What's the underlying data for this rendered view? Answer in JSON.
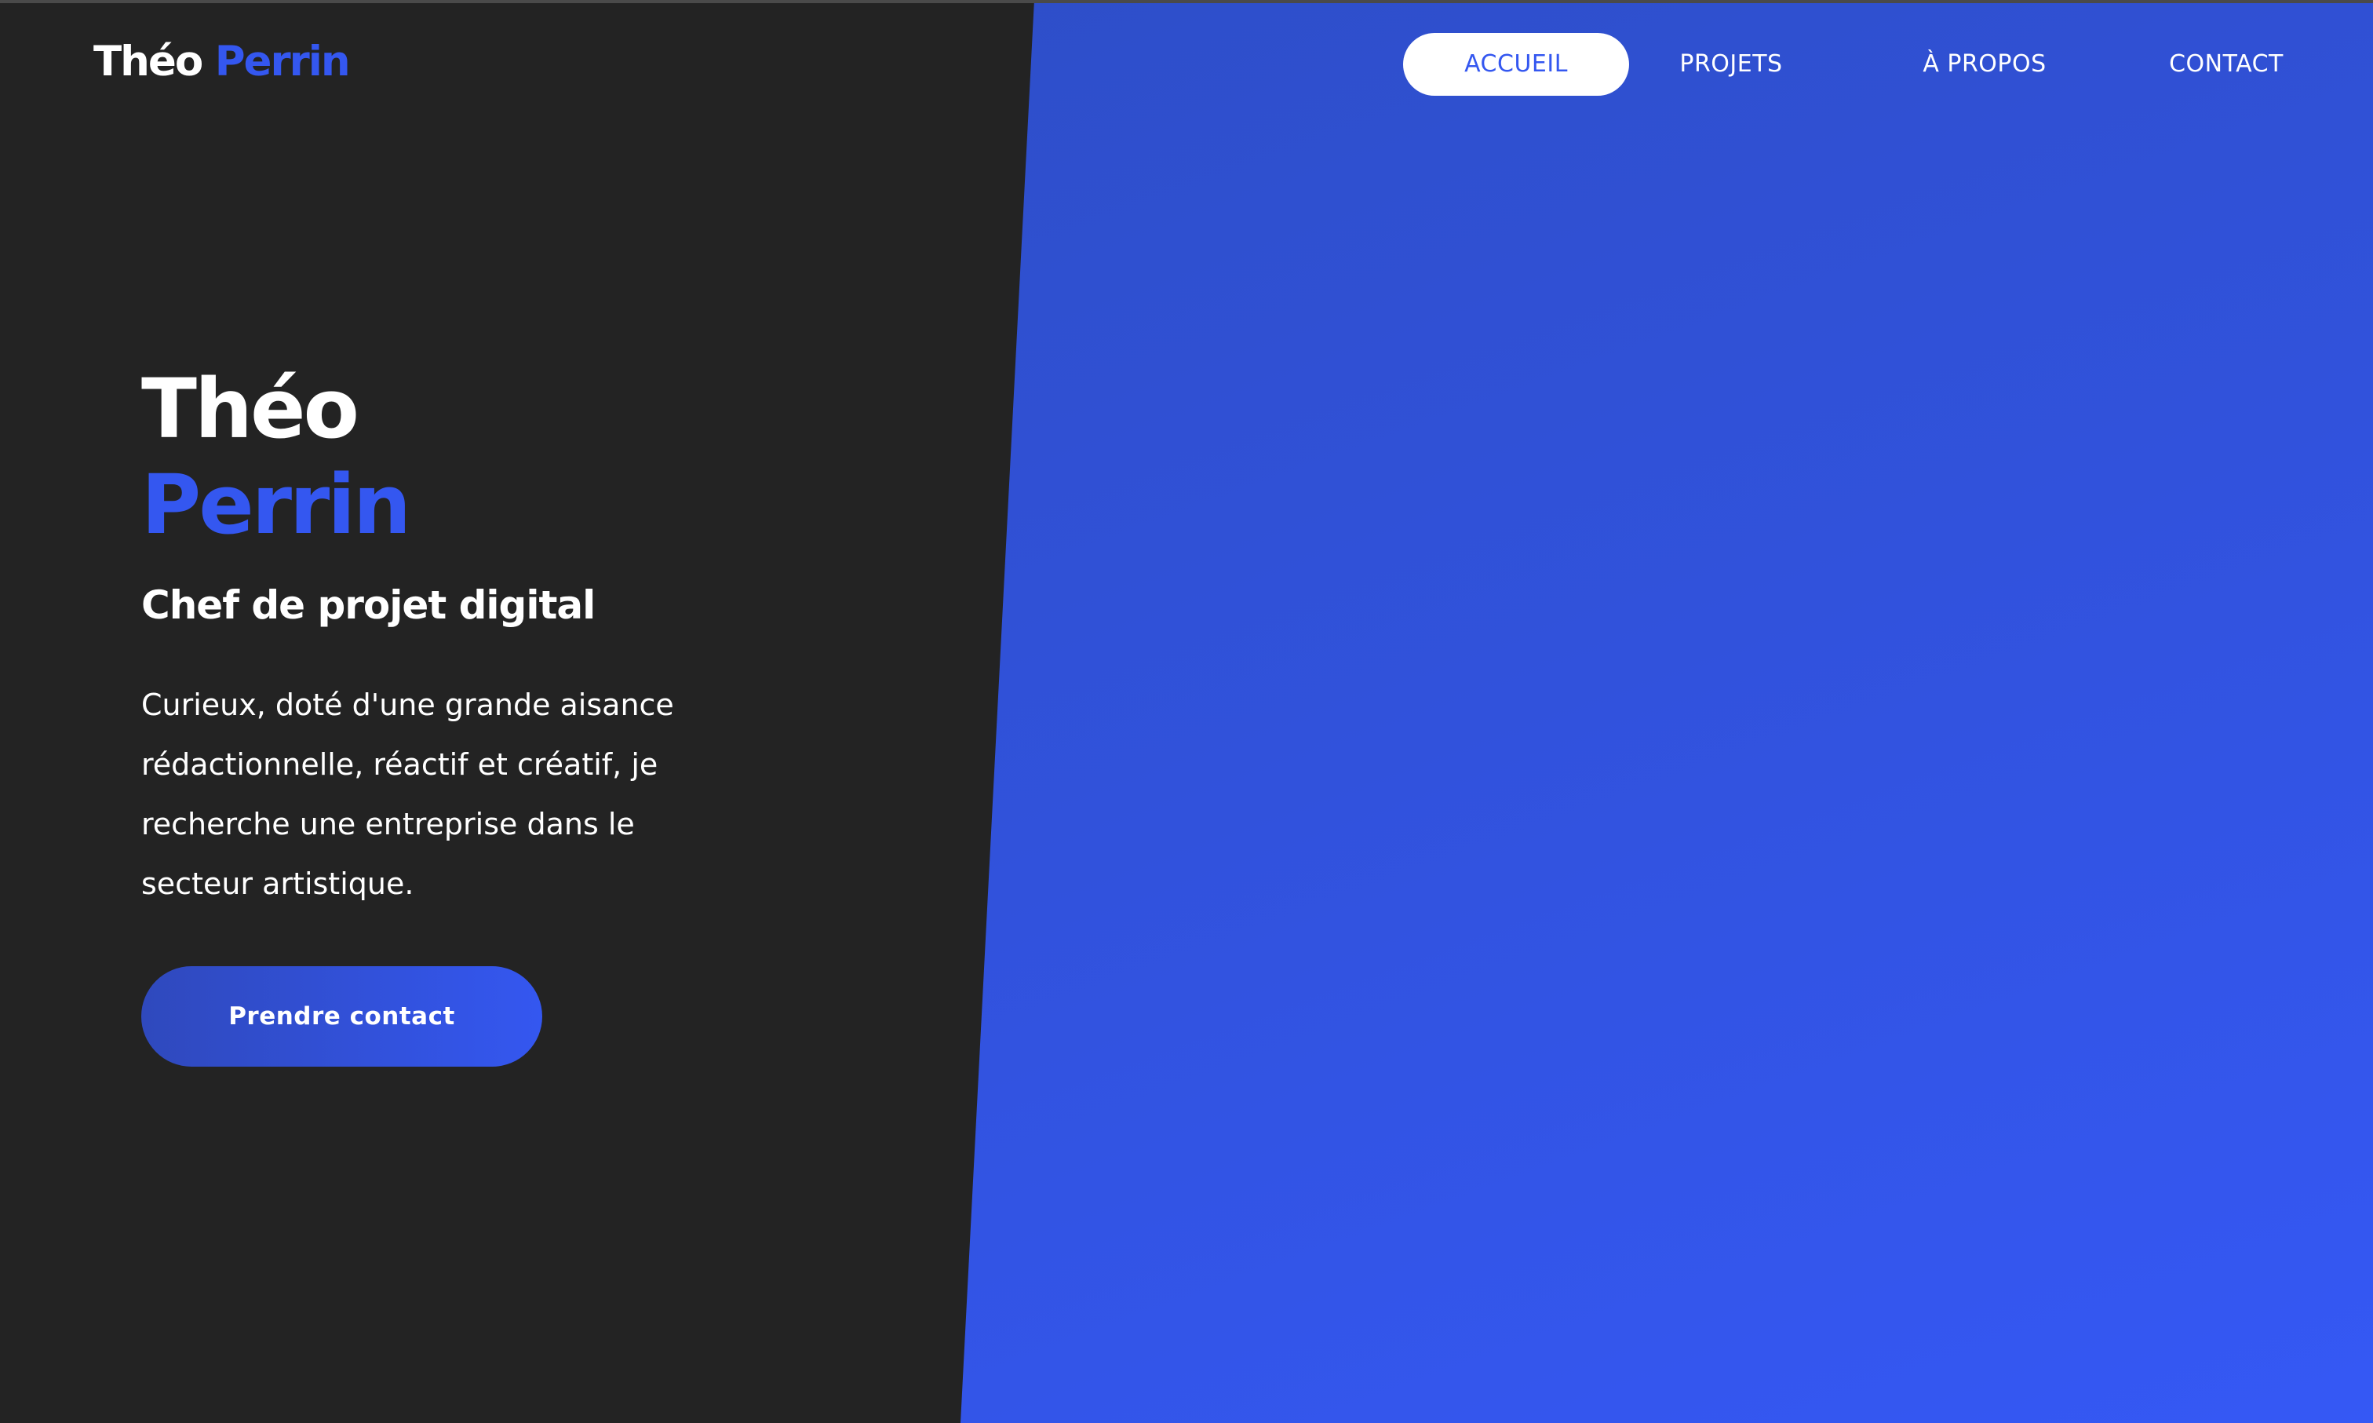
{
  "brand": {
    "first_name": "Théo",
    "last_name": "Perrin"
  },
  "nav": {
    "items": [
      {
        "label": "ACCUEIL",
        "active": true
      },
      {
        "label": "PROJETS",
        "active": false
      },
      {
        "label": "À PROPOS",
        "active": false
      },
      {
        "label": "CONTACT",
        "active": false
      }
    ]
  },
  "hero": {
    "first_name": "Théo",
    "last_name": "Perrin",
    "role": "Chef de projet digital",
    "description": "Curieux, doté d'une grande aisance rédactionnelle, réactif et créatif, je recherche une entreprise dans le secteur artistique.",
    "cta_label": "Prendre contact"
  },
  "colors": {
    "background_dark": "#232323",
    "accent_blue": "#3457f0",
    "panel_blue_start": "#2d4dc2",
    "panel_blue_end": "#3558f5",
    "text": "#ffffff"
  }
}
